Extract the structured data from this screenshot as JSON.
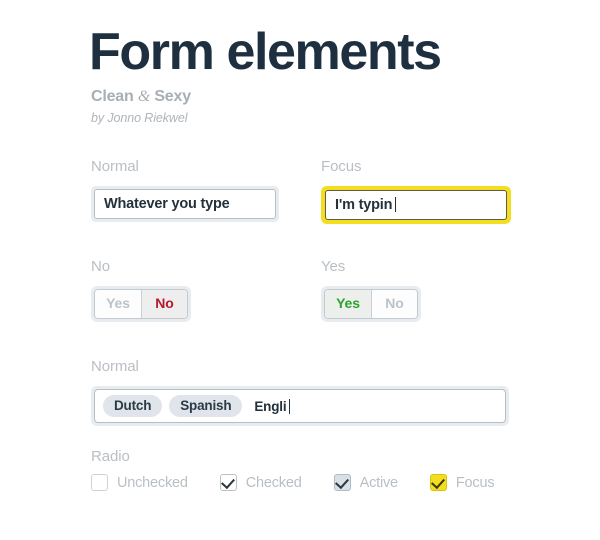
{
  "header": {
    "title": "Form elements",
    "subtitle_before": "Clean ",
    "subtitle_amp": "&",
    "subtitle_after": " Sexy",
    "byline": "by Jonno Riekwel"
  },
  "text_inputs": {
    "normal": {
      "label": "Normal",
      "value": "Whatever you type"
    },
    "focus": {
      "label": "Focus",
      "value": "I'm typin"
    }
  },
  "toggles": {
    "no_group": {
      "label": "No",
      "options": [
        "Yes",
        "No"
      ],
      "selected": "No",
      "yes_label": "Yes",
      "no_label": "No"
    },
    "yes_group": {
      "label": "Yes",
      "options": [
        "Yes",
        "No"
      ],
      "selected": "Yes",
      "yes_label": "Yes",
      "no_label": "No"
    }
  },
  "tags_input": {
    "label": "Normal",
    "tags": [
      "Dutch",
      "Spanish"
    ],
    "typing": "Engli"
  },
  "radio": {
    "label": "Radio",
    "items": [
      {
        "label": "Unchecked",
        "state": "unchecked"
      },
      {
        "label": "Checked",
        "state": "checked"
      },
      {
        "label": "Active",
        "state": "active"
      },
      {
        "label": "Focus",
        "state": "focus"
      }
    ]
  },
  "colors": {
    "title": "#1e3040",
    "label_gray": "#b9bfc4",
    "focus_yellow": "#f2dd1f",
    "toggle_no_red": "#b5192f",
    "toggle_yes_green": "#2ca32c",
    "input_glow": "#e7ecf0"
  }
}
